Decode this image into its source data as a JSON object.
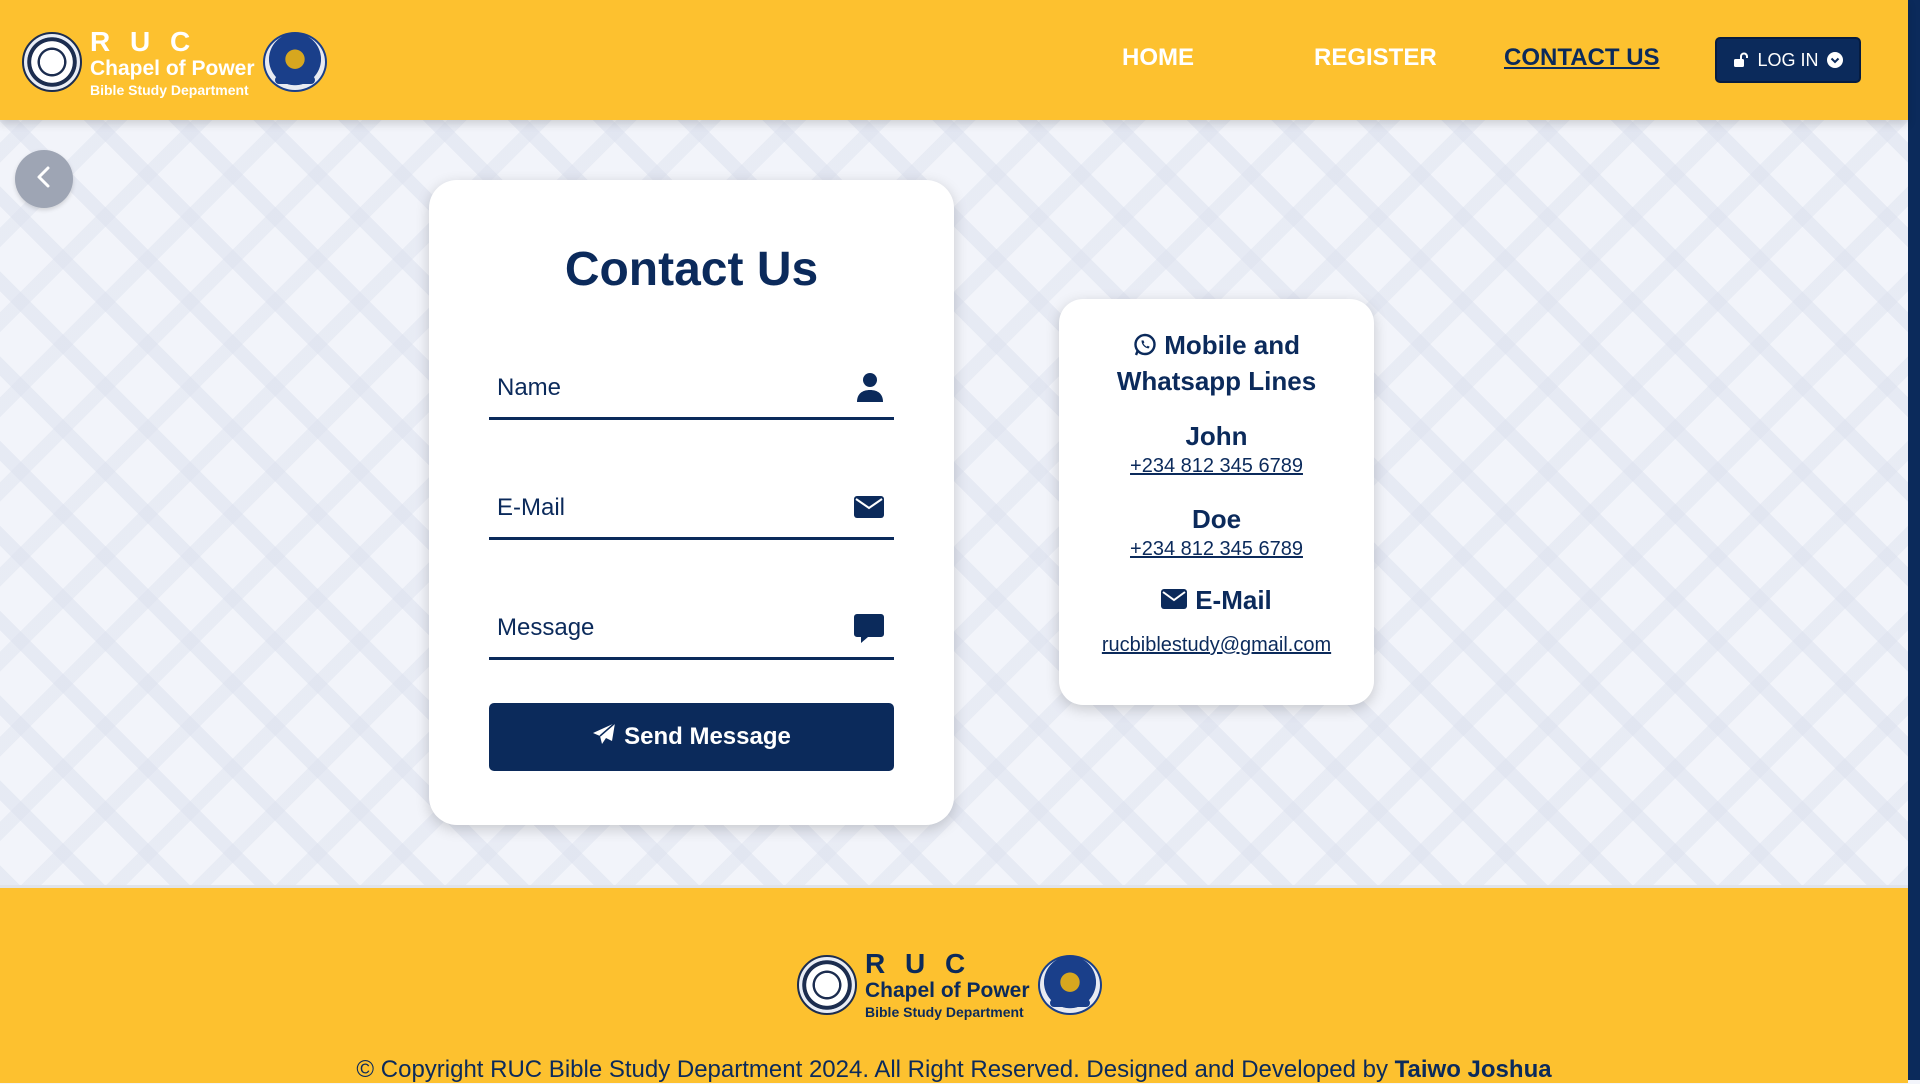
{
  "brand": {
    "line1": "R U C",
    "line2": "Chapel of Power",
    "line3": "Bible Study Department"
  },
  "nav": {
    "home": "HOME",
    "register": "REGISTER",
    "contact": "CONTACT US",
    "login": "LOG IN"
  },
  "contact_form": {
    "title": "Contact Us",
    "name_placeholder": "Name",
    "email_placeholder": "E-Mail",
    "message_placeholder": "Message",
    "send_label": "Send Message"
  },
  "info": {
    "title_line1": "Mobile and",
    "title_line2": "Whatsapp Lines",
    "contacts": [
      {
        "name": "John",
        "phone": "+234 812 345 6789"
      },
      {
        "name": "Doe",
        "phone": "+234 812 345 6789"
      }
    ],
    "email_heading": "E-Mail",
    "email": "rucbiblestudy@gmail.com"
  },
  "footer": {
    "copyright": "© Copyright RUC Bible Study Department 2024. All Right Reserved. Designed and Developed by",
    "author": "Taiwo Joshua"
  },
  "colors": {
    "primary": "#0b2a5b",
    "accent": "#fdc12f"
  },
  "icons": {
    "back": "chevron-left-icon",
    "user": "user-icon",
    "email": "envelope-icon",
    "message": "comment-icon",
    "send": "paper-plane-icon",
    "whatsapp": "whatsapp-icon",
    "login": "unlock-icon"
  }
}
